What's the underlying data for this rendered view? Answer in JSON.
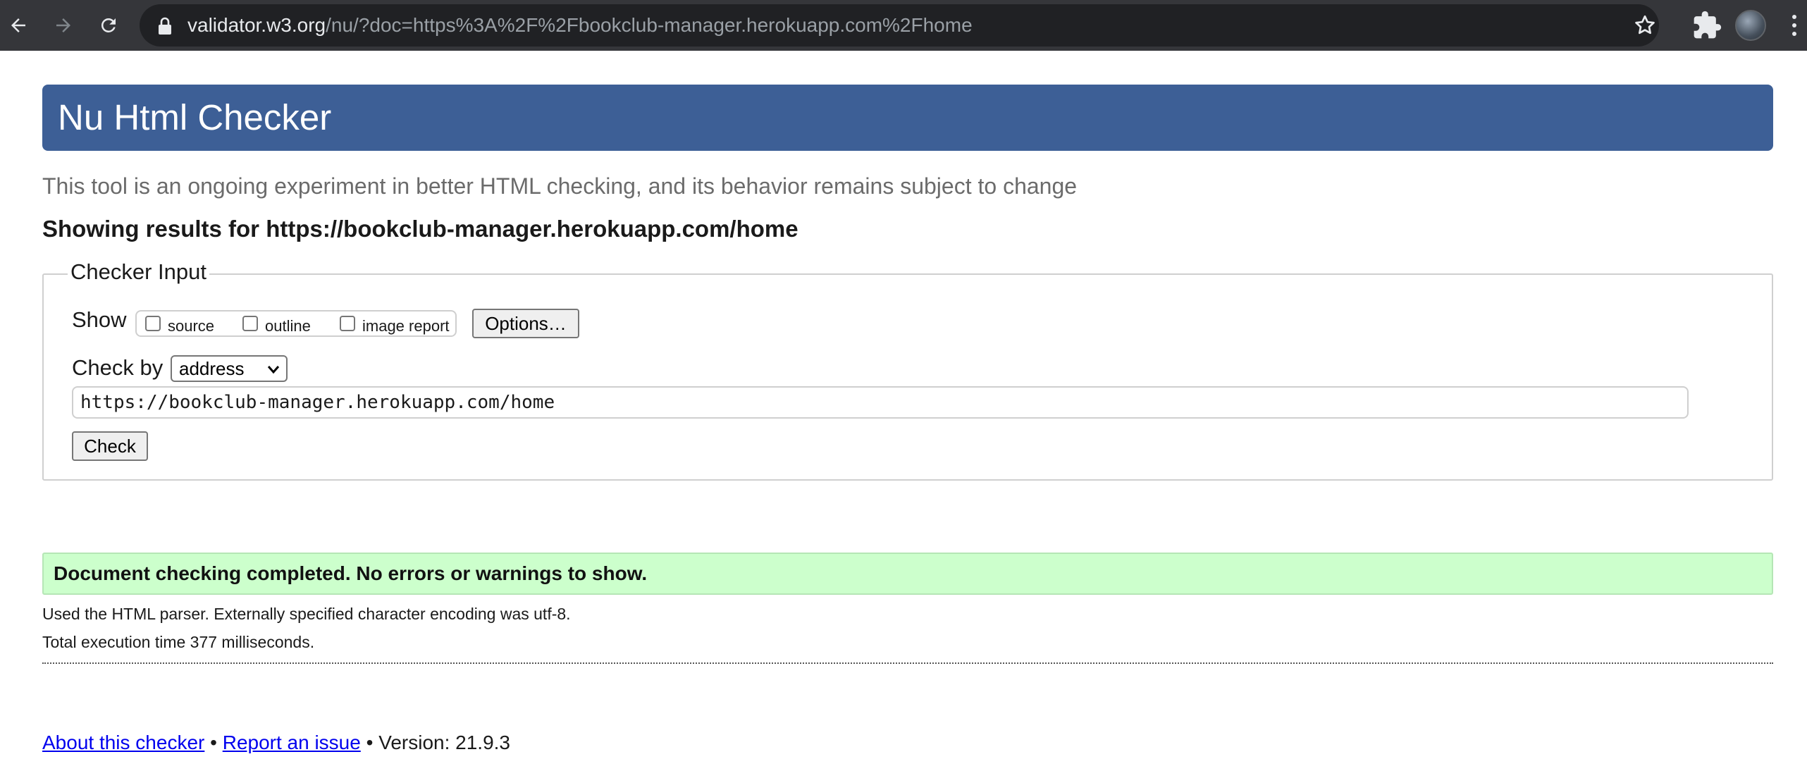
{
  "browser": {
    "url_host": "validator.w3.org",
    "url_path": "/nu/?doc=https%3A%2F%2Fbookclub-manager.herokuapp.com%2Fhome",
    "icons": [
      "back-arrow-icon",
      "forward-arrow-icon",
      "reload-icon",
      "lock-icon",
      "star-icon",
      "puzzle-icon",
      "avatar",
      "kebab-menu-icon"
    ]
  },
  "header": {
    "title": "Nu Html Checker",
    "tagline": "This tool is an ongoing experiment in better HTML checking, and its behavior remains subject to change",
    "results_heading": "Showing results for https://bookclub-manager.herokuapp.com/home"
  },
  "checker_input": {
    "legend": "Checker Input",
    "show_label": "Show",
    "show_options": [
      {
        "label": "source",
        "checked": false
      },
      {
        "label": "outline",
        "checked": false
      },
      {
        "label": "image report",
        "checked": false
      }
    ],
    "options_button": "Options…",
    "check_by_label": "Check by",
    "check_by_value": "address",
    "address_value": "https://bookclub-manager.herokuapp.com/home",
    "check_button": "Check"
  },
  "result": {
    "message": "Document checking completed. No errors or warnings to show.",
    "parser_info": "Used the HTML parser. Externally specified character encoding was utf-8.",
    "execution_time": "Total execution time 377 milliseconds."
  },
  "footer": {
    "about_link": "About this checker",
    "separator": "•",
    "report_link": "Report an issue",
    "version": "Version: 21.9.3"
  },
  "colors": {
    "banner": "#3d5f96",
    "success_bg": "#ccffcc",
    "link": "#0000ee",
    "chrome_toolbar": "#35363a"
  }
}
